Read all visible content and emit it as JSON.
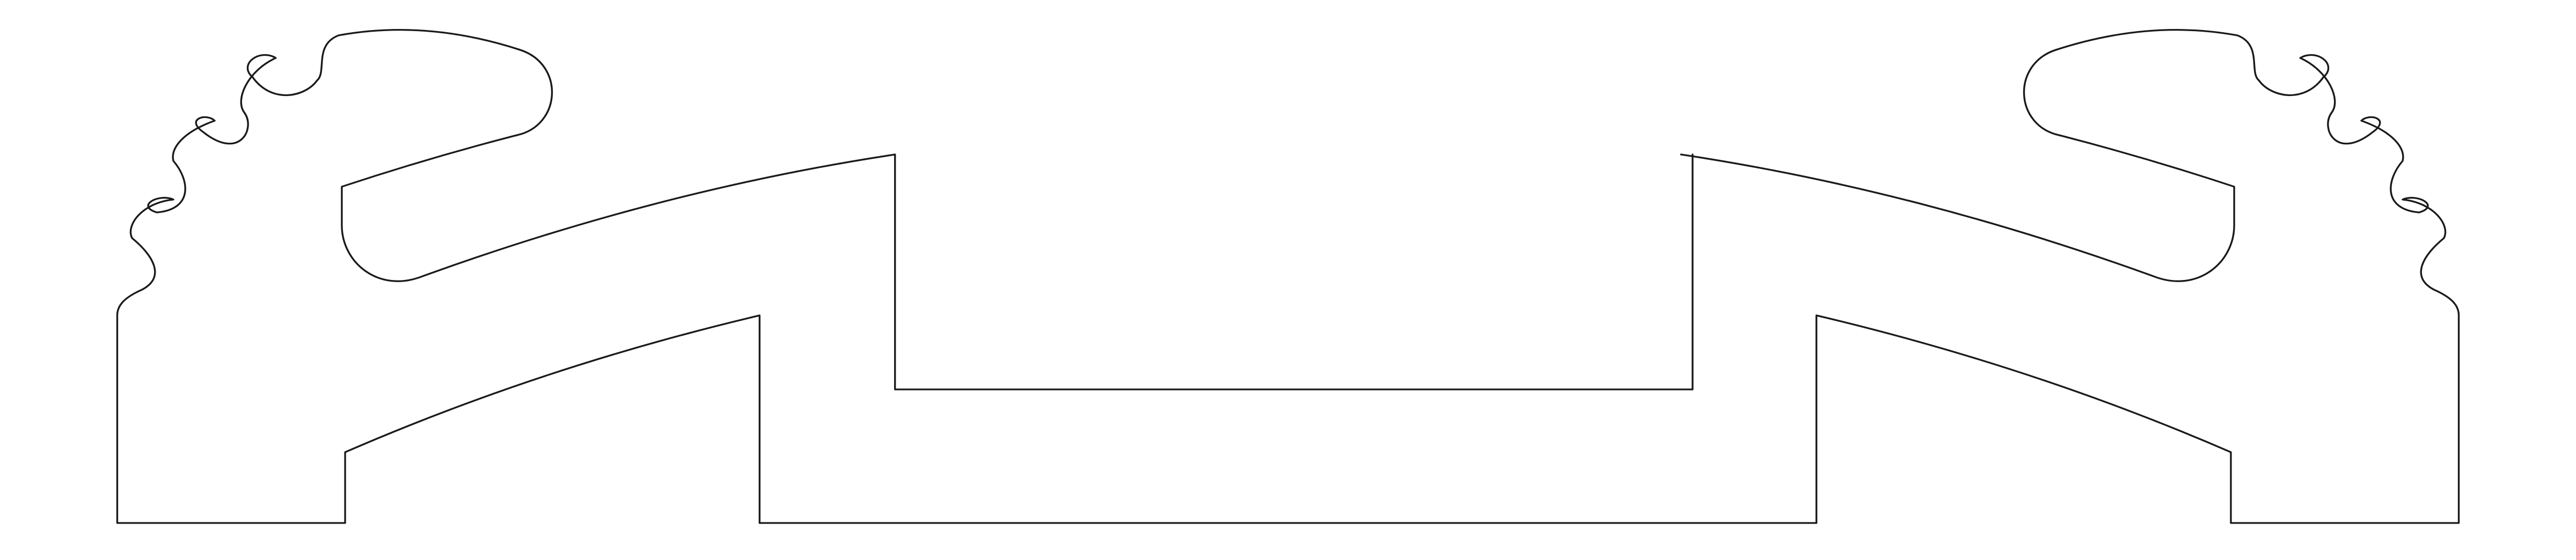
{
  "figure": {
    "kind": "profile-cross-section-outline",
    "background_color": "#ffffff",
    "line_color": "#1a1a1a"
  }
}
